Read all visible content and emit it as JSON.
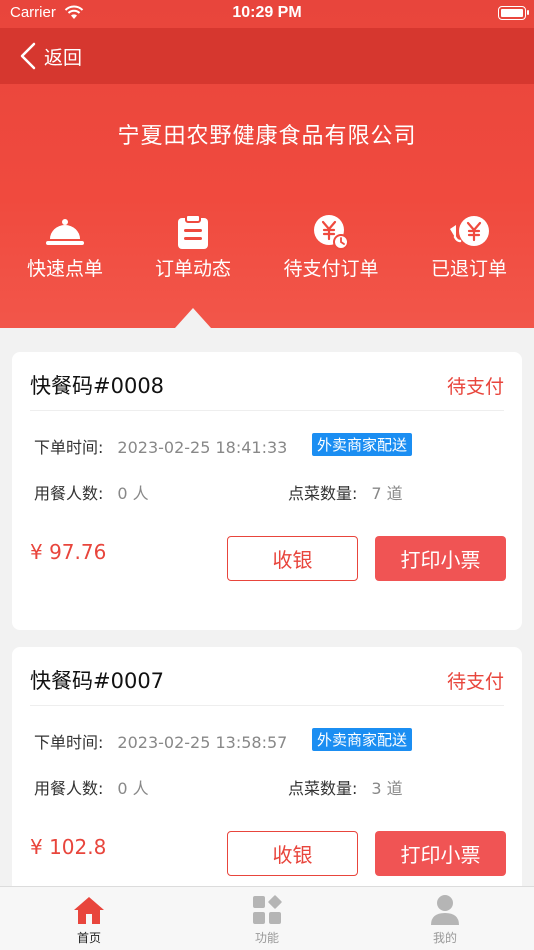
{
  "status_bar": {
    "carrier": "Carrier",
    "time": "10:29 PM"
  },
  "nav": {
    "back_label": "返回"
  },
  "header": {
    "company": "宁夏田农野健康食品有限公司"
  },
  "menu": [
    {
      "label": "快速点单",
      "icon": "food-cloche-icon"
    },
    {
      "label": "订单动态",
      "icon": "clipboard-icon"
    },
    {
      "label": "待支付订单",
      "icon": "yen-clock-icon"
    },
    {
      "label": "已退订单",
      "icon": "yen-refund-icon"
    }
  ],
  "orders": [
    {
      "code": "快餐码#0008",
      "status": "待支付",
      "order_time_label": "下单时间:",
      "order_time": "2023-02-25 18:41:33",
      "delivery_tag": "外卖商家配送",
      "diners_label": "用餐人数:",
      "diners": "0 人",
      "dishes_label": "点菜数量:",
      "dishes": "7 道",
      "price": "¥ 97.76",
      "cash_label": "收银",
      "print_label": "打印小票"
    },
    {
      "code": "快餐码#0007",
      "status": "待支付",
      "order_time_label": "下单时间:",
      "order_time": "2023-02-25 13:58:57",
      "delivery_tag": "外卖商家配送",
      "diners_label": "用餐人数:",
      "diners": "0 人",
      "dishes_label": "点菜数量:",
      "dishes": "3 道",
      "price": "¥ 102.8",
      "cash_label": "收银",
      "print_label": "打印小票"
    }
  ],
  "tabbar": [
    {
      "label": "首页",
      "icon": "home-icon",
      "active": true
    },
    {
      "label": "功能",
      "icon": "grid-icon",
      "active": false
    },
    {
      "label": "我的",
      "icon": "user-icon",
      "active": false
    }
  ],
  "colors": {
    "accent": "#e8453c",
    "tag_blue": "#1b8ef2",
    "inactive": "#b5b5b5"
  }
}
